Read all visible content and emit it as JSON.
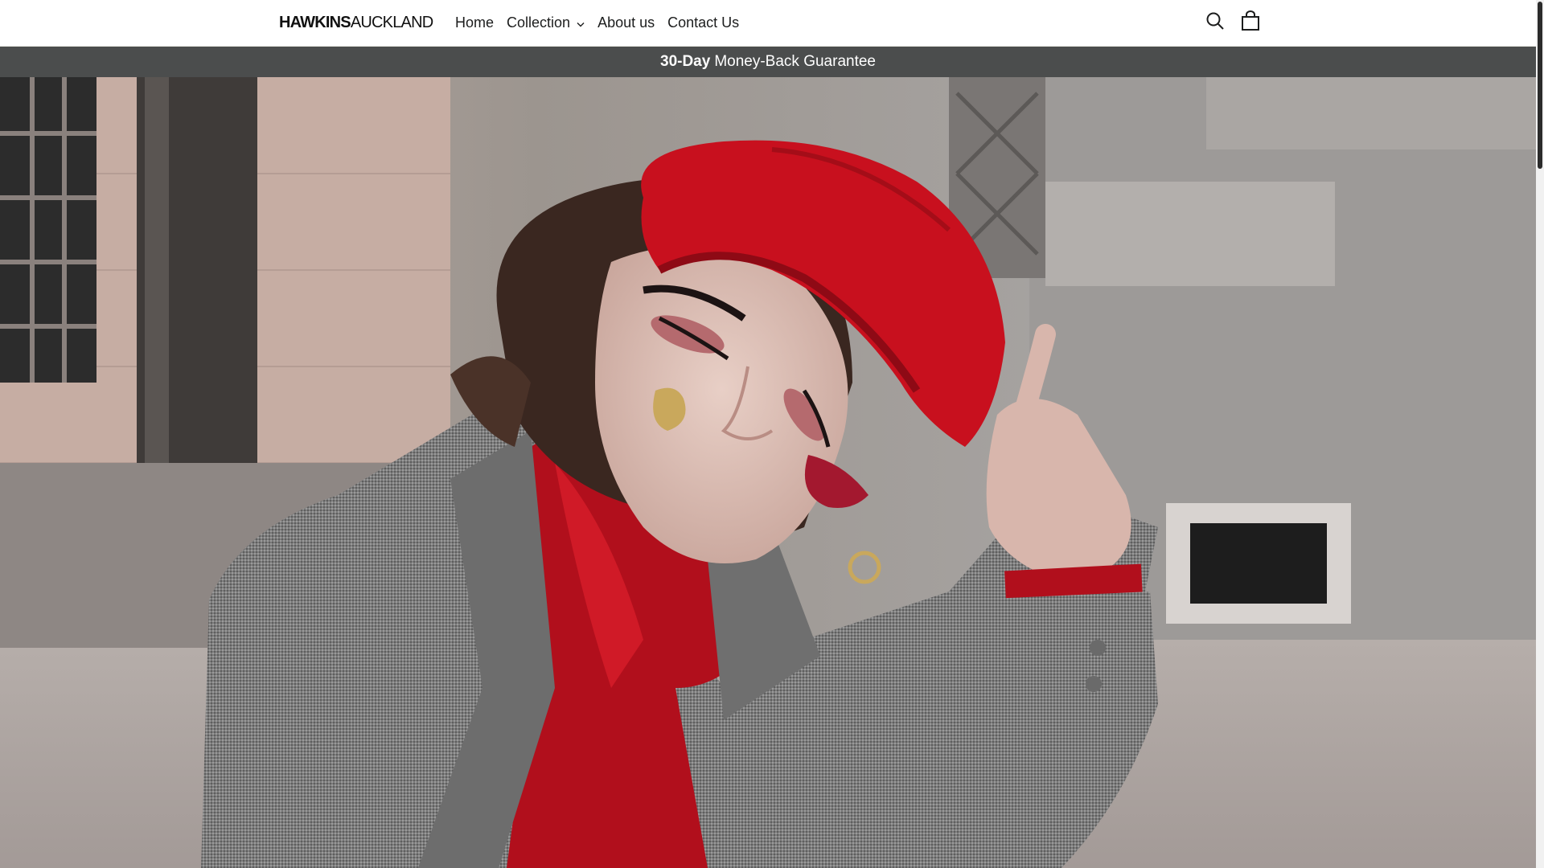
{
  "header": {
    "logo": {
      "bold": "HAWKINS",
      "light": "AUCKLAND"
    },
    "nav": [
      {
        "label": "Home"
      },
      {
        "label": "Collection",
        "has_dropdown": true
      },
      {
        "label": "About us"
      },
      {
        "label": "Contact Us"
      }
    ],
    "icons": [
      "search-icon",
      "cart-icon"
    ]
  },
  "announcement": {
    "bold": "30-Day",
    "text": "Money-Back Guarantee",
    "background": "#4b4d4d"
  },
  "colors": {
    "accent_red": "#c8101e",
    "text": "#1c1d1d"
  }
}
